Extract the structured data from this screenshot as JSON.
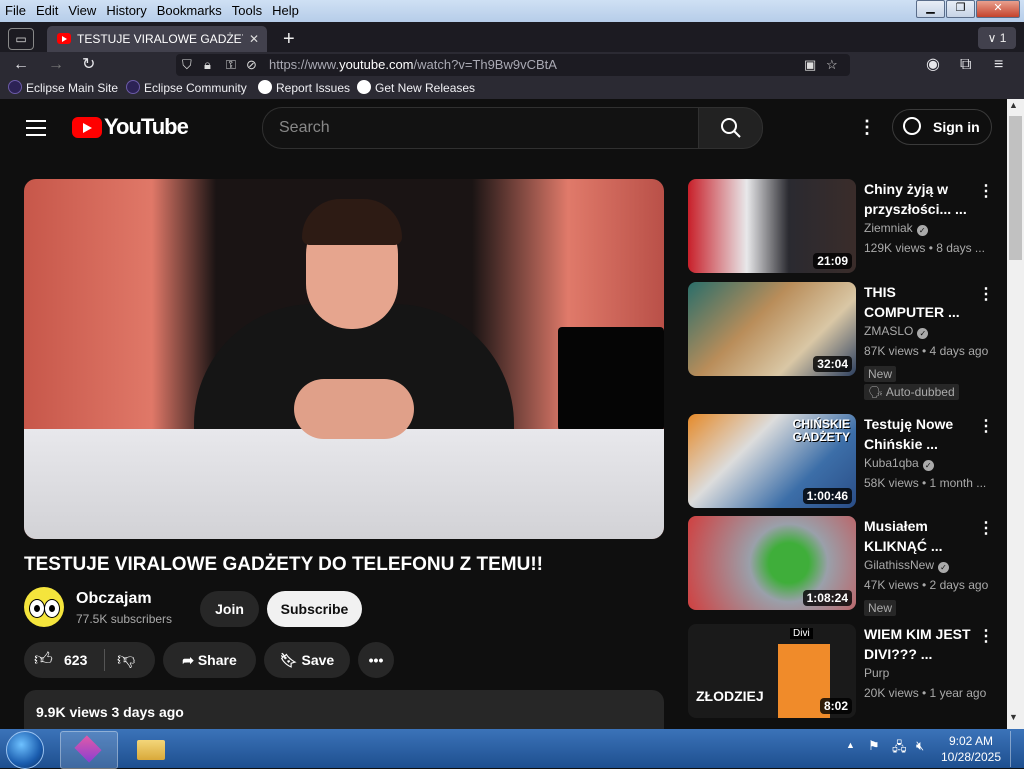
{
  "menubar": {
    "items": [
      "File",
      "Edit",
      "View",
      "History",
      "Bookmarks",
      "Tools",
      "Help"
    ]
  },
  "tab": {
    "title": "TESTUJE VIRALOWE GADŻETY D",
    "close": "✕",
    "new_tab": "+",
    "tab_count": "1"
  },
  "address": {
    "prefix": "https://www.",
    "domain": "youtube.com",
    "path": "/watch?v=Th9Bw9vCBtA"
  },
  "bookmarks": [
    "Eclipse Main Site",
    "Eclipse Community",
    "Report Issues",
    "Get New Releases"
  ],
  "youtube": {
    "logo": "YouTube",
    "search_placeholder": "Search",
    "signin": "Sign in",
    "video_title": "TESTUJE VIRALOWE GADŻETY DO TELEFONU Z TEMU!!",
    "channel": {
      "name": "Obczajam",
      "subs": "77.5K subscribers"
    },
    "join": "Join",
    "subscribe": "Subscribe",
    "likes": "623",
    "share": "Share",
    "save": "Save",
    "desc_views": "9.9K views  3 days ago"
  },
  "recommendations": [
    {
      "title": "Chiny żyją w przyszłości... ...",
      "channel": "Ziemniak",
      "meta": "129K views • 8 days ...",
      "duration": "21:09",
      "badges": []
    },
    {
      "title": "THIS COMPUTER ...",
      "channel": "ZMASLO",
      "meta": "87K views • 4 days ago",
      "duration": "32:04",
      "badges": [
        "New",
        "Auto-dubbed"
      ]
    },
    {
      "title": "Testuję Nowe Chińskie ...",
      "channel": "Kuba1qba",
      "meta": "58K views • 1 month ...",
      "duration": "1:00:46",
      "badges": []
    },
    {
      "title": "Musiałem KLIKNĄĆ ...",
      "channel": "GilathissNew",
      "meta": "47K views • 2 days ago",
      "duration": "1:08:24",
      "badges": [
        "New"
      ]
    },
    {
      "title": "WIEM KIM JEST DIVI??? ...",
      "channel": "Purp",
      "meta": "20K views • 1 year ago",
      "duration": "8:02",
      "badges": []
    }
  ],
  "thumb_text": {
    "t3": "CHIŃSKIE GADŻETY",
    "t5_label": "Divi",
    "t5_big": "ZŁODZIEJ"
  },
  "taskbar": {
    "time": "9:02 AM",
    "date": "10/28/2025"
  }
}
